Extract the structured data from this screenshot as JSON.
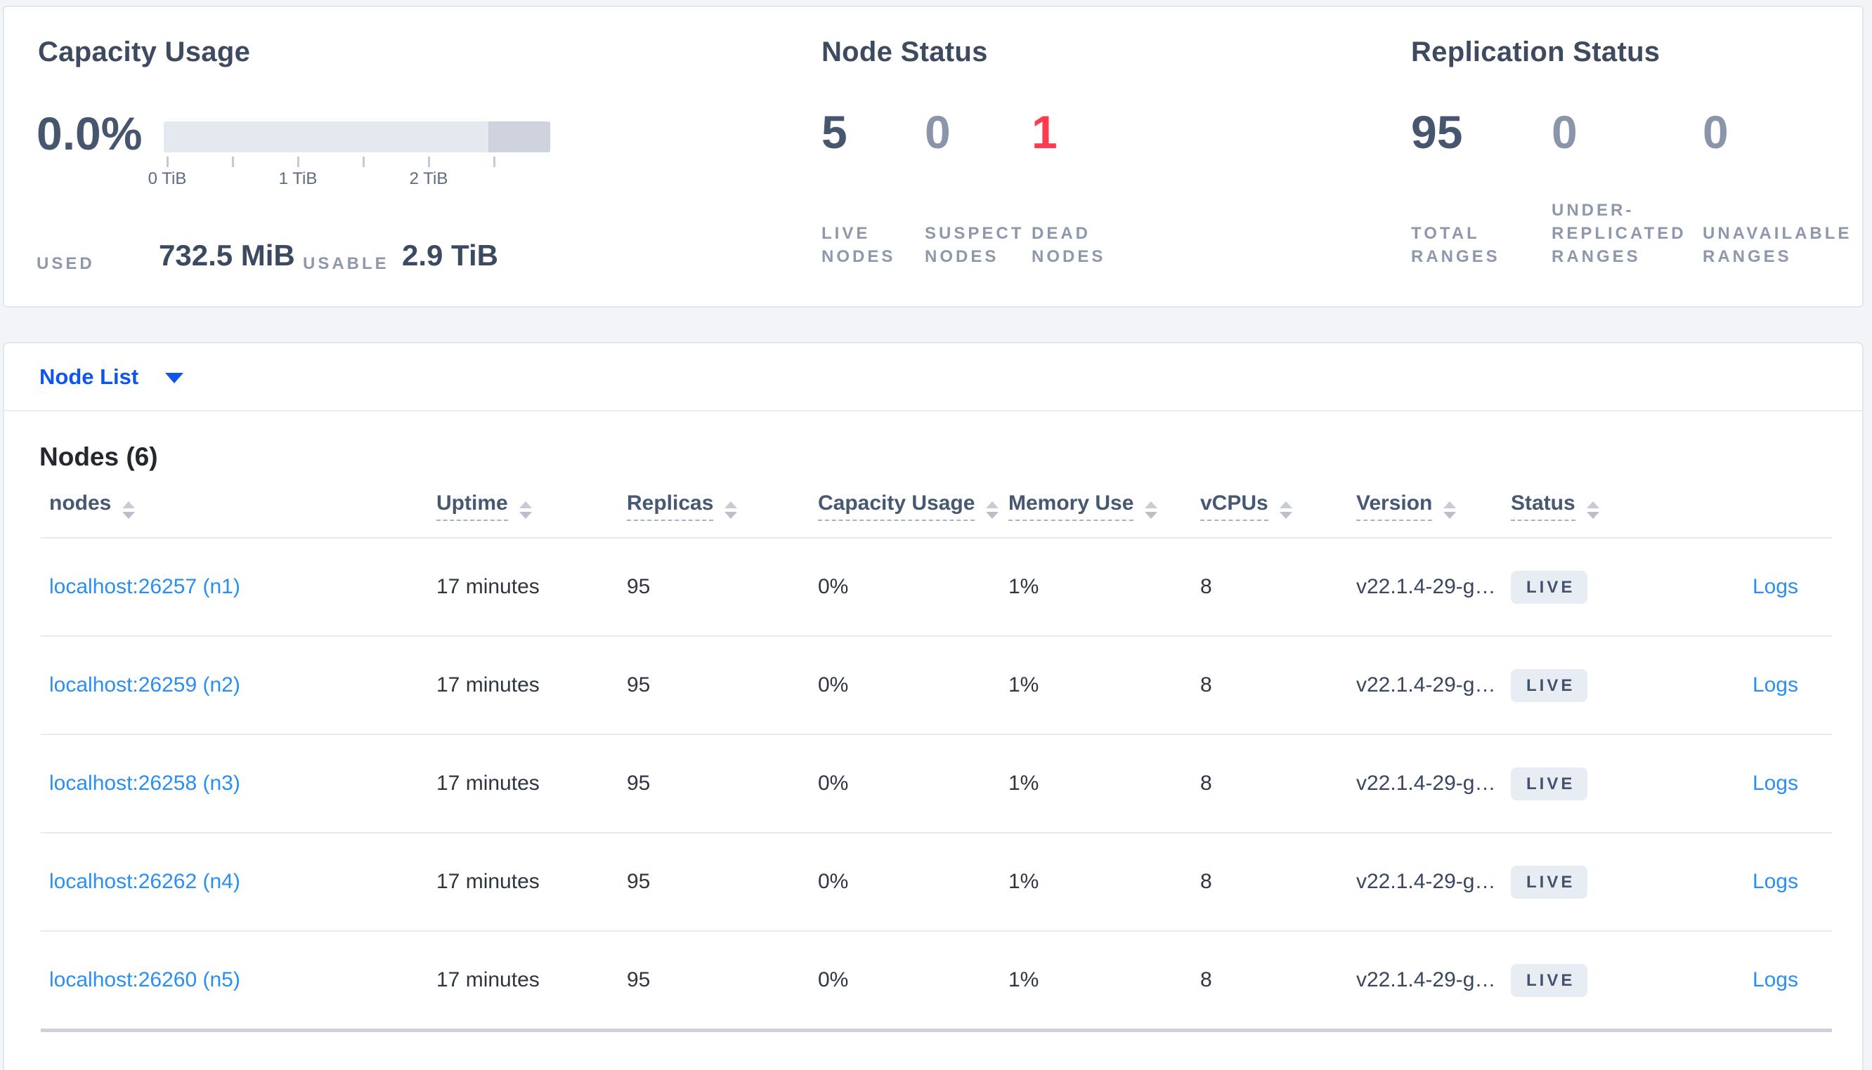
{
  "capacity_card": {
    "title": "Capacity Usage",
    "percent": "0.0%",
    "axis_ticks": [
      "0 TiB",
      "1 TiB",
      "2 TiB"
    ],
    "used_label": "USED",
    "used_value": "732.5 MiB",
    "usable_label": "USABLE",
    "usable_value": "2.9 TiB"
  },
  "node_status_card": {
    "title": "Node Status",
    "stats": [
      {
        "value": "5",
        "label": "LIVE NODES"
      },
      {
        "value": "0",
        "label": "SUSPECT NODES"
      },
      {
        "value": "1",
        "label": "DEAD NODES"
      }
    ]
  },
  "replication_card": {
    "title": "Replication Status",
    "stats": [
      {
        "value": "95",
        "label": "TOTAL RANGES"
      },
      {
        "value": "0",
        "label": "UNDER-REPLICATED RANGES"
      },
      {
        "value": "0",
        "label": "UNAVAILABLE RANGES"
      }
    ]
  },
  "view_selector": {
    "label": "Node List"
  },
  "nodes_table": {
    "heading": "Nodes (6)",
    "columns": {
      "nodes": "nodes",
      "uptime": "Uptime",
      "replicas": "Replicas",
      "capacity": "Capacity Usage",
      "memory": "Memory Use",
      "vcpus": "vCPUs",
      "version": "Version",
      "status": "Status"
    },
    "rows": [
      {
        "node": "localhost:26257 (n1)",
        "uptime": "17 minutes",
        "replicas": "95",
        "capacity_usage": "0%",
        "memory_use": "1%",
        "vcpus": "8",
        "version": "v22.1.4-29-g…",
        "status": "LIVE",
        "logs_label": "Logs"
      },
      {
        "node": "localhost:26259 (n2)",
        "uptime": "17 minutes",
        "replicas": "95",
        "capacity_usage": "0%",
        "memory_use": "1%",
        "vcpus": "8",
        "version": "v22.1.4-29-g…",
        "status": "LIVE",
        "logs_label": "Logs"
      },
      {
        "node": "localhost:26258 (n3)",
        "uptime": "17 minutes",
        "replicas": "95",
        "capacity_usage": "0%",
        "memory_use": "1%",
        "vcpus": "8",
        "version": "v22.1.4-29-g…",
        "status": "LIVE",
        "logs_label": "Logs"
      },
      {
        "node": "localhost:26262 (n4)",
        "uptime": "17 minutes",
        "replicas": "95",
        "capacity_usage": "0%",
        "memory_use": "1%",
        "vcpus": "8",
        "version": "v22.1.4-29-g…",
        "status": "LIVE",
        "logs_label": "Logs"
      },
      {
        "node": "localhost:26260 (n5)",
        "uptime": "17 minutes",
        "replicas": "95",
        "capacity_usage": "0%",
        "memory_use": "1%",
        "vcpus": "8",
        "version": "v22.1.4-29-g…",
        "status": "LIVE",
        "logs_label": "Logs"
      }
    ]
  },
  "colors": {
    "link_blue": "#2a8ef2",
    "selector_blue": "#0f56ed",
    "danger_red": "#ff3b4f",
    "primary_slate": "#46566f",
    "muted_slate": "#8b95aa",
    "badge_bg": "#e8ecf3",
    "page_bg": "#f2f4f8"
  }
}
